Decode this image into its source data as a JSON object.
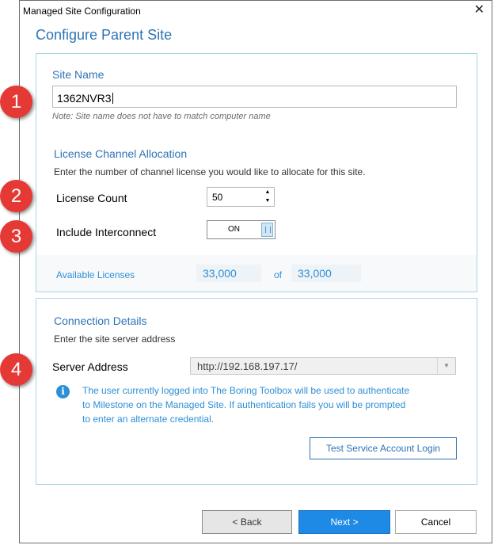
{
  "window": {
    "title": "Managed Site Configuration"
  },
  "dialog": {
    "title": "Configure Parent Site"
  },
  "site": {
    "heading": "Site Name",
    "value": "1362NVR3",
    "note": "Note: Site name does not have to match computer name"
  },
  "license": {
    "heading": "License Channel Allocation",
    "description": "Enter the number of channel license you would like to allocate for this site.",
    "count_label": "License Count",
    "count_value": "50",
    "interconnect_label": "Include Interconnect",
    "interconnect_state": "ON",
    "available_label": "Available Licenses",
    "available_value": "33,000",
    "of_text": "of",
    "total_value": "33,000"
  },
  "connection": {
    "heading": "Connection Details",
    "description": "Enter the site server address",
    "server_label": "Server Address",
    "server_value": "http://192.168.197.17/",
    "info_line1": "The user currently logged into The Boring Toolbox will be used to authenticate",
    "info_line2": "to Milestone on the Managed Site. If authentication fails you will be prompted",
    "info_line3": "to enter an alternate credential.",
    "test_button": "Test Service Account Login"
  },
  "footer": {
    "back_label": "<   Back",
    "next_label": "Next   >",
    "cancel_label": "Cancel"
  },
  "markers": [
    "1",
    "2",
    "3",
    "4"
  ],
  "colors": {
    "accent": "#2e74b5",
    "link": "#2e8fd6",
    "primary_button": "#1e8ae6",
    "marker": "#e53935"
  }
}
